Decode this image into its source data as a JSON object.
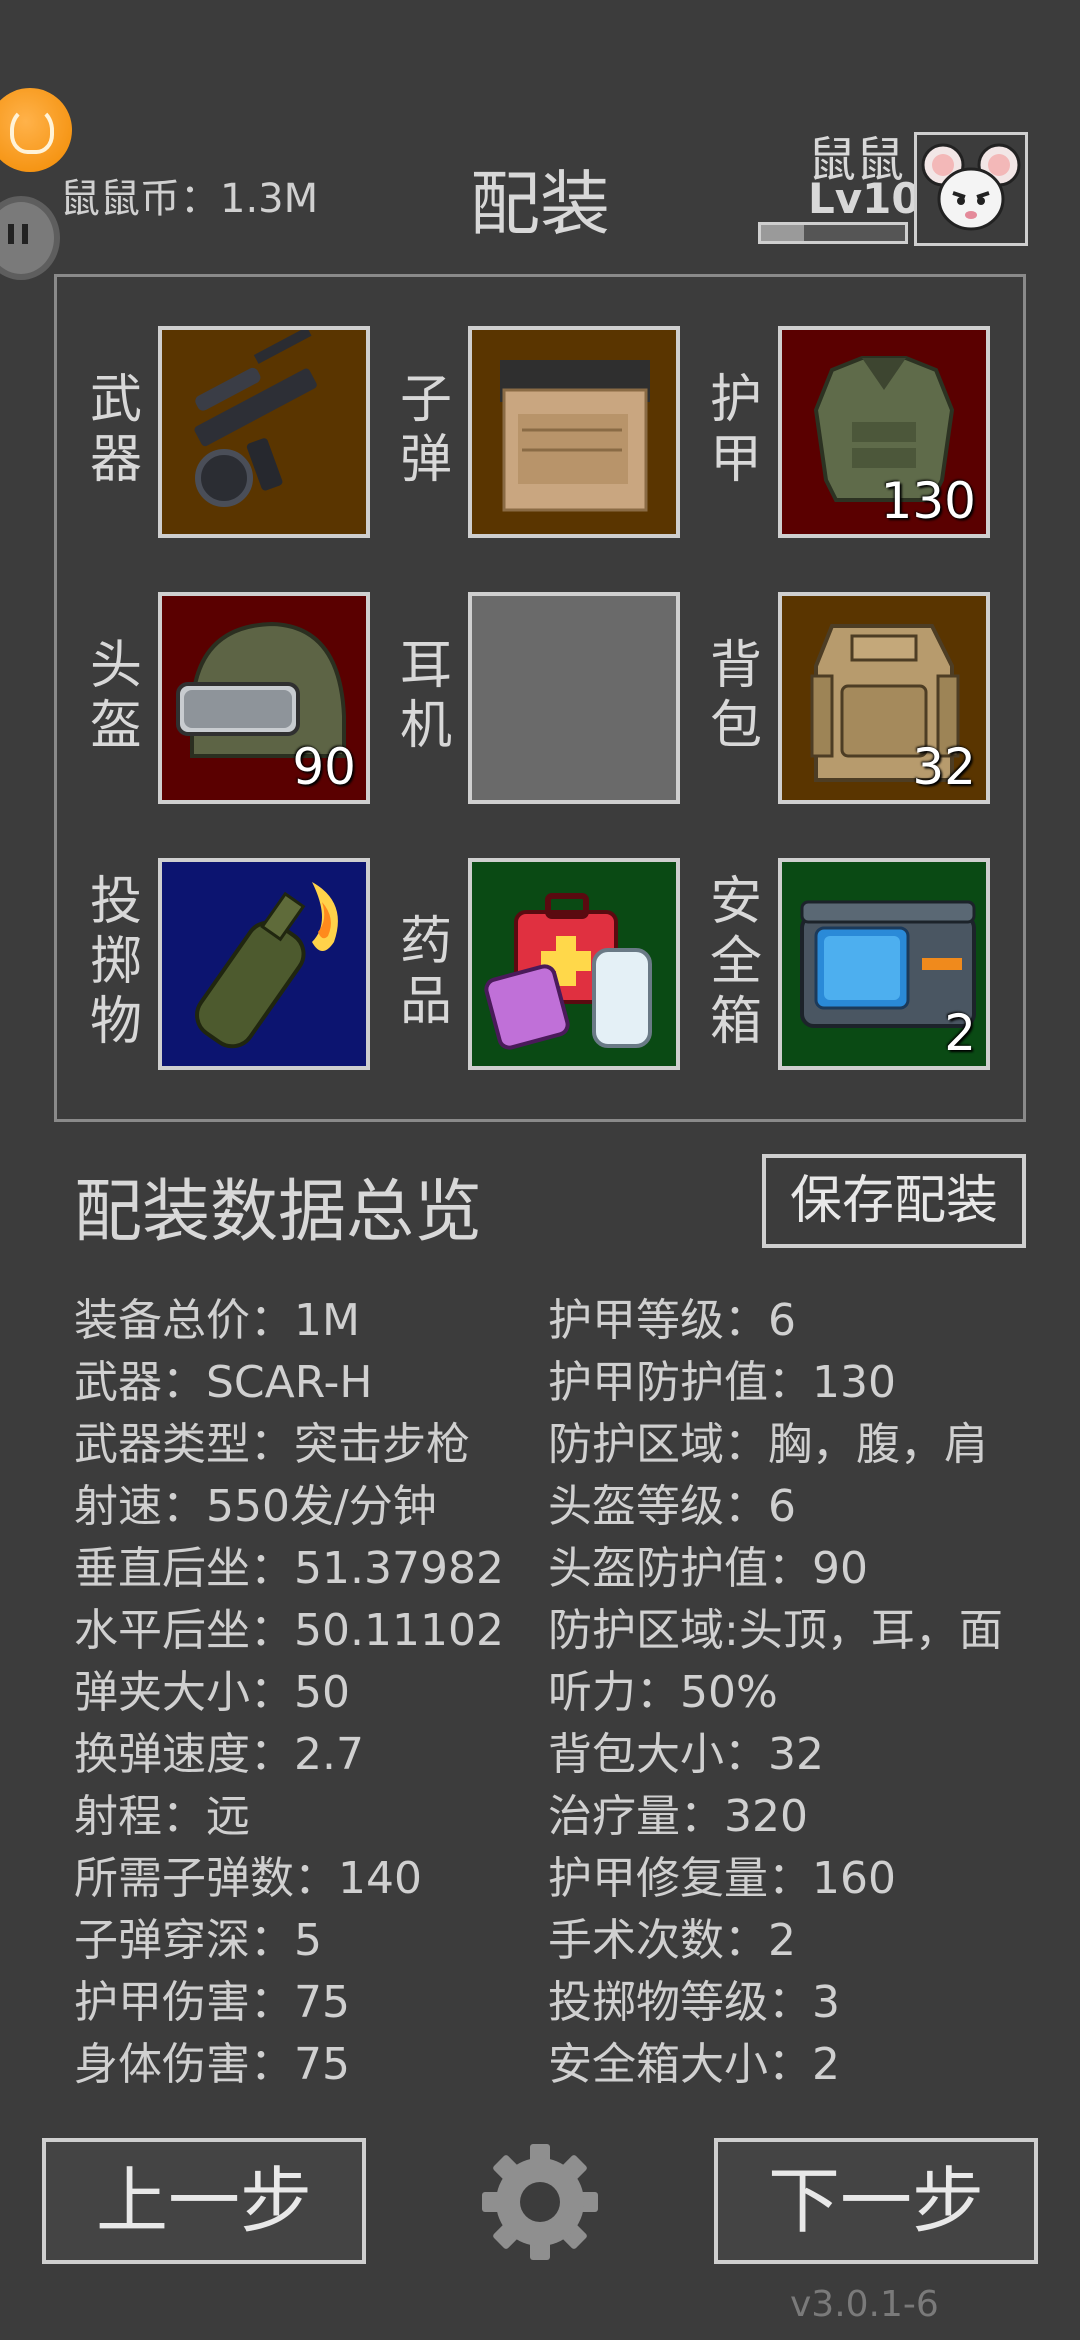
{
  "header": {
    "coins_label": "鼠鼠币：1.3M",
    "title": "配装",
    "player_name": "鼠鼠",
    "player_level": "Lv10",
    "xp_progress": 0.3
  },
  "slots": [
    {
      "label": "武器",
      "count": "",
      "bg": "#5a3500"
    },
    {
      "label": "子弹",
      "count": "",
      "bg": "#5a3500"
    },
    {
      "label": "护甲",
      "count": "130",
      "bg": "#5a0000"
    },
    {
      "label": "头盔",
      "count": "90",
      "bg": "#5a0000"
    },
    {
      "label": "耳机",
      "count": "",
      "bg": "#6a6a6a"
    },
    {
      "label": "背包",
      "count": "32",
      "bg": "#5a3500"
    },
    {
      "label": "投掷物",
      "count": "",
      "bg": "#0c1470"
    },
    {
      "label": "药品",
      "count": "",
      "bg": "#0a4a14"
    },
    {
      "label": "安全箱",
      "count": "2",
      "bg": "#0a4a14"
    }
  ],
  "summary": {
    "title": "配装数据总览",
    "save_label": "保存配装",
    "left_stats": [
      "装备总价：1M",
      "武器：SCAR-H",
      "武器类型：突击步枪",
      "射速：550发/分钟",
      "垂直后坐：51.37982",
      "水平后坐：50.11102",
      "弹夹大小：50",
      "换弹速度：2.7",
      "射程：远",
      "所需子弹数：140",
      "子弹穿深：5",
      "护甲伤害：75",
      "身体伤害：75"
    ],
    "right_stats": [
      "护甲等级：6",
      "护甲防护值：130",
      "防护区域：胸，腹，肩",
      "头盔等级：6",
      "头盔防护值：90",
      "防护区域:头顶，耳，面",
      "听力：50%",
      "背包大小：32",
      "治疗量：320",
      "护甲修复量：160",
      "手术次数：2",
      "投掷物等级：3",
      "安全箱大小：2"
    ]
  },
  "footer": {
    "prev_label": "上一步",
    "next_label": "下一步",
    "version": "v3.0.1-6"
  }
}
